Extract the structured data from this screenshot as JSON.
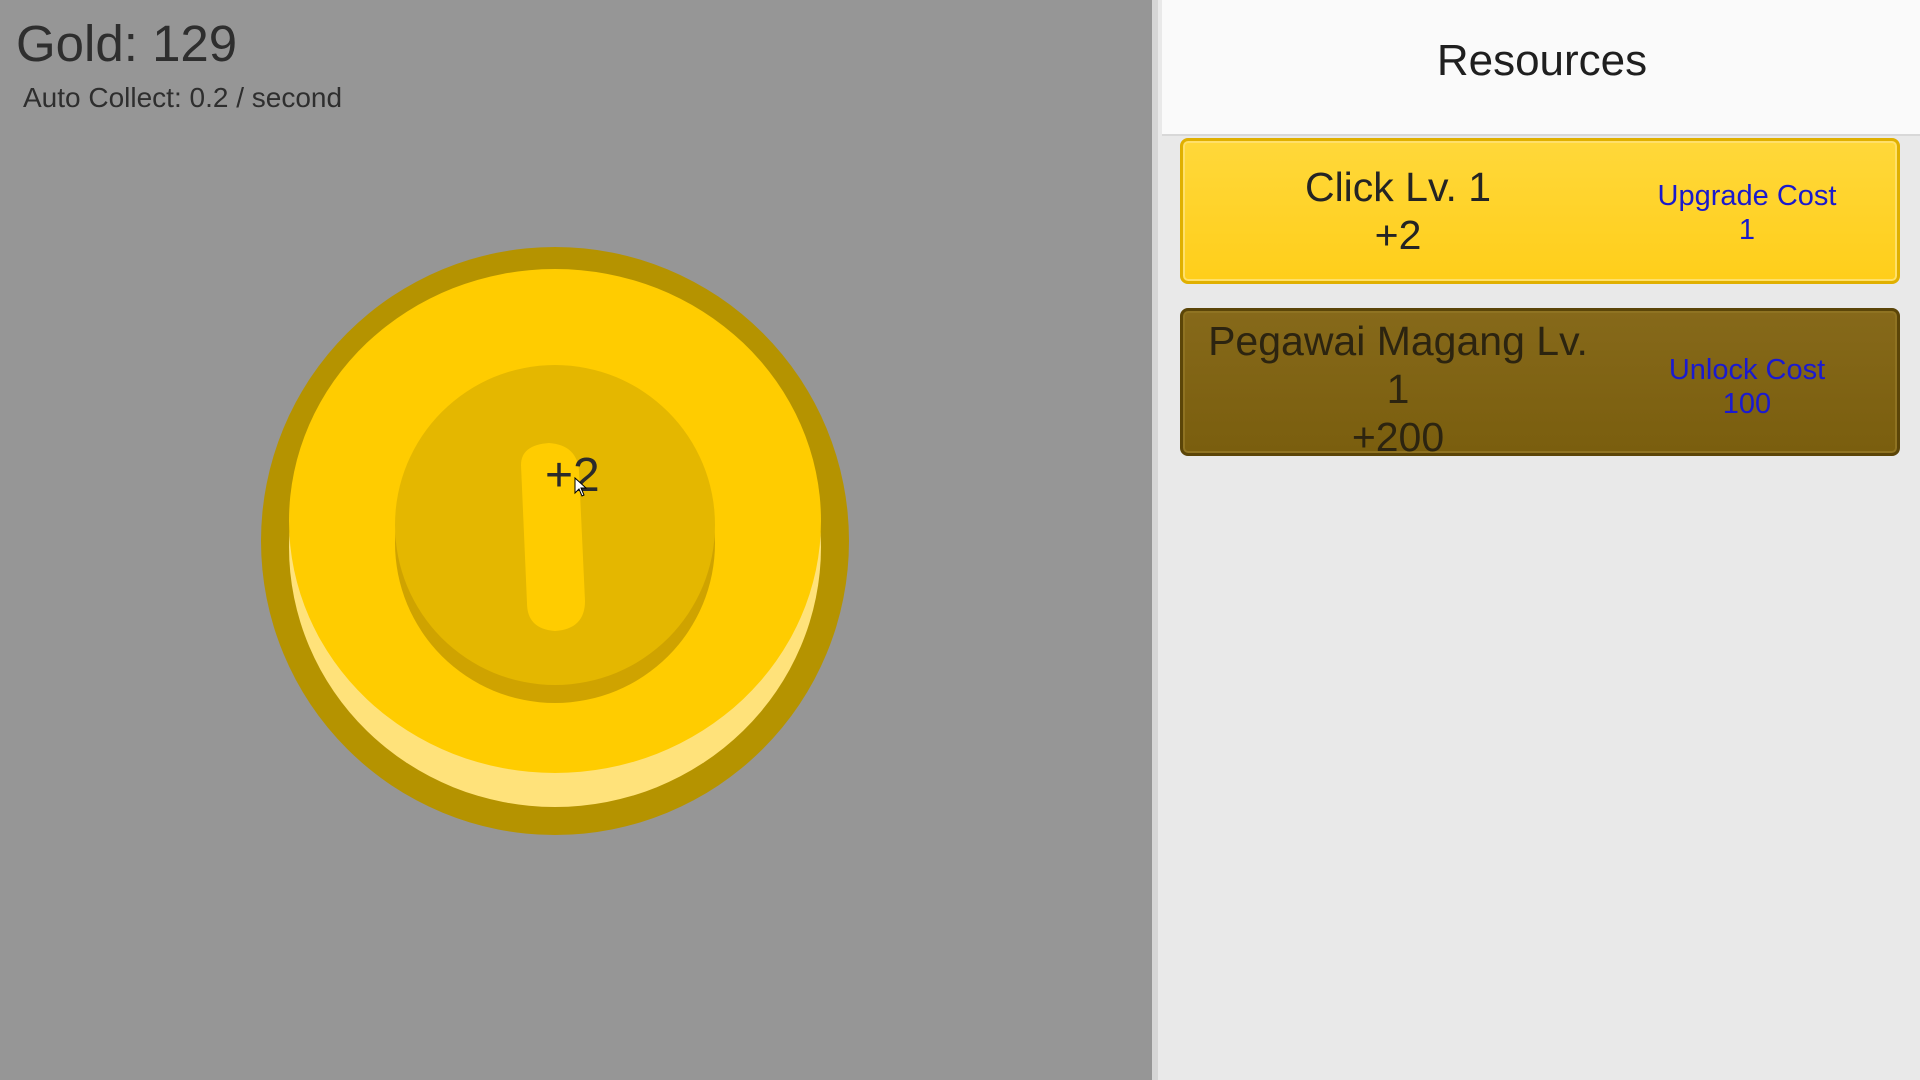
{
  "hud": {
    "gold": "Gold: 129",
    "auto_collect": "Auto Collect: 0.2 / second"
  },
  "coin": {
    "popup": "+2",
    "colors": {
      "rim": "#b59300",
      "face": "#ffcc00",
      "highlight": "#ffe27a",
      "inner": "#e4b700",
      "inner_shadow": "#cfa300"
    }
  },
  "panel": {
    "title": "Resources",
    "cards": [
      {
        "name": "Click Lv. 1",
        "bonus": "+2",
        "cost_label": "Upgrade Cost",
        "cost_value": "1",
        "state": "available"
      },
      {
        "name": "Pegawai Magang Lv.",
        "level": "1",
        "bonus": "+200",
        "cost_label": "Unlock Cost",
        "cost_value": "100",
        "state": "locked"
      }
    ]
  }
}
